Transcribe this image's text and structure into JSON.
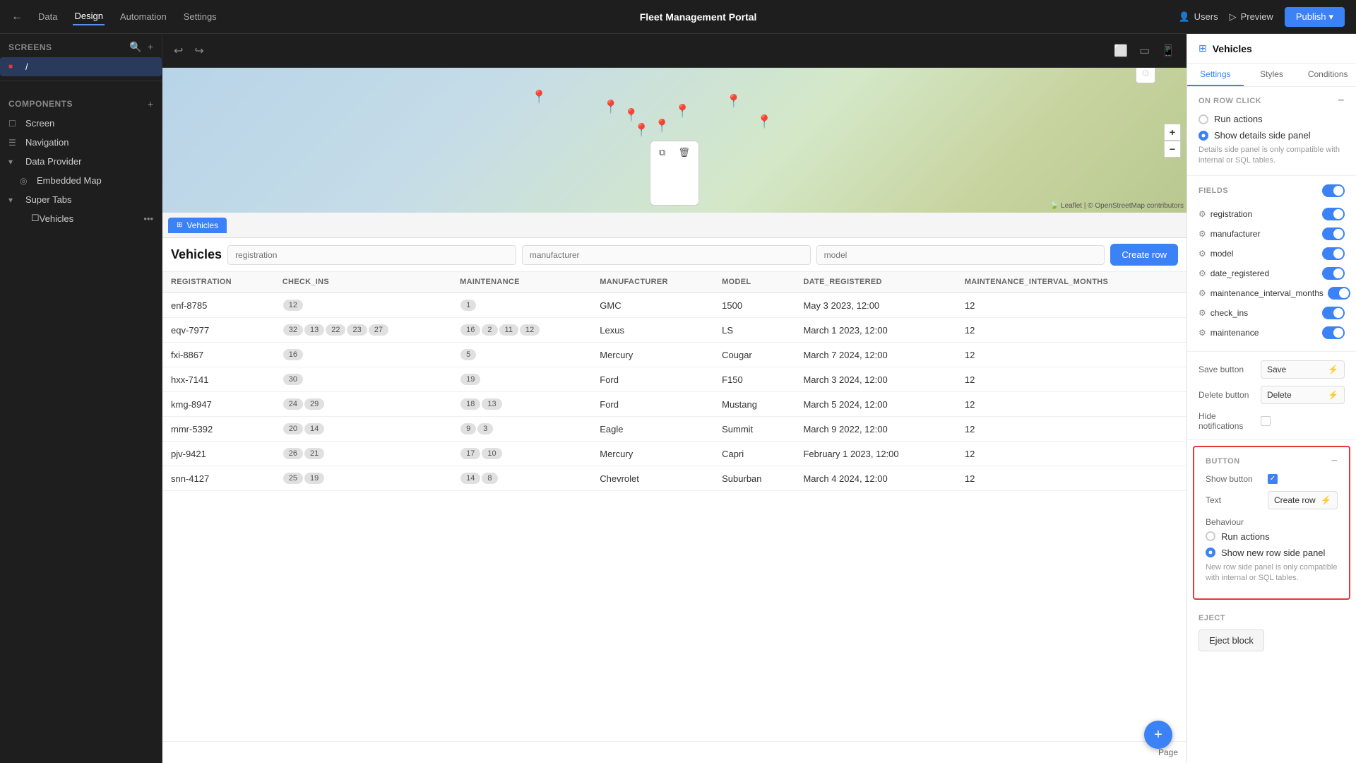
{
  "topNav": {
    "backLabel": "←",
    "tabs": [
      "Data",
      "Design",
      "Automation",
      "Settings"
    ],
    "activeTab": "Design",
    "appTitle": "Fleet Management Portal",
    "usersLabel": "Users",
    "previewLabel": "Preview",
    "publishLabel": "Publish"
  },
  "leftSidebar": {
    "screensTitle": "Screens",
    "screenItem": "/",
    "componentsTitle": "Components",
    "addIcon": "+",
    "items": [
      {
        "label": "Screen",
        "icon": "☐"
      },
      {
        "label": "Navigation",
        "icon": "☰"
      },
      {
        "label": "Data Provider",
        "icon": "◉"
      },
      {
        "label": "Embedded Map",
        "icon": "◎"
      },
      {
        "label": "Super Tabs",
        "icon": "⊞"
      },
      {
        "label": "Vehicles",
        "icon": "☐"
      }
    ]
  },
  "canvas": {
    "tableTabLabel": "Vehicles",
    "tableTitle": "Vehicles",
    "searchPlaceholders": [
      "registration",
      "manufacturer",
      "model"
    ],
    "createRowLabel": "Create row",
    "columns": [
      "REGISTRATION",
      "CHECK_INS",
      "MAINTENANCE",
      "MANUFACTURER",
      "MODEL",
      "DATE_REGISTERED",
      "MAINTENANCE_INTERVAL_MONTHS"
    ],
    "rows": [
      {
        "registration": "enf-8785",
        "check_ins": [
          "12"
        ],
        "maintenance": [
          "1"
        ],
        "manufacturer": "GMC",
        "model": "1500",
        "date_registered": "May 3 2023, 12:00",
        "maintenance_interval": "12"
      },
      {
        "registration": "eqv-7977",
        "check_ins": [
          "32",
          "13",
          "22",
          "23",
          "27"
        ],
        "maintenance": [
          "16",
          "2",
          "11",
          "12"
        ],
        "manufacturer": "Lexus",
        "model": "LS",
        "date_registered": "March 1 2023, 12:00",
        "maintenance_interval": "12"
      },
      {
        "registration": "fxi-8867",
        "check_ins": [
          "16"
        ],
        "maintenance": [
          "5"
        ],
        "manufacturer": "Mercury",
        "model": "Cougar",
        "date_registered": "March 7 2024, 12:00",
        "maintenance_interval": "12"
      },
      {
        "registration": "hxx-7141",
        "check_ins": [
          "30"
        ],
        "maintenance": [
          "19"
        ],
        "manufacturer": "Ford",
        "model": "F150",
        "date_registered": "March 3 2024, 12:00",
        "maintenance_interval": "12"
      },
      {
        "registration": "kmg-8947",
        "check_ins": [
          "24",
          "29"
        ],
        "maintenance": [
          "18",
          "13"
        ],
        "manufacturer": "Ford",
        "model": "Mustang",
        "date_registered": "March 5 2024, 12:00",
        "maintenance_interval": "12"
      },
      {
        "registration": "mmr-5392",
        "check_ins": [
          "20",
          "14"
        ],
        "maintenance": [
          "9",
          "3"
        ],
        "manufacturer": "Eagle",
        "model": "Summit",
        "date_registered": "March 9 2022, 12:00",
        "maintenance_interval": "12"
      },
      {
        "registration": "pjv-9421",
        "check_ins": [
          "26",
          "21"
        ],
        "maintenance": [
          "17",
          "10"
        ],
        "manufacturer": "Mercury",
        "model": "Capri",
        "date_registered": "February 1 2023, 12:00",
        "maintenance_interval": "12"
      },
      {
        "registration": "snn-4127",
        "check_ins": [
          "25",
          "19"
        ],
        "maintenance": [
          "14",
          "8"
        ],
        "manufacturer": "Chevrolet",
        "model": "Suburban",
        "date_registered": "March 4 2024, 12:00",
        "maintenance_interval": "12"
      }
    ],
    "footerLabel": "Page",
    "fabIcon": "+"
  },
  "rightPanel": {
    "title": "Vehicles",
    "tabs": [
      "Settings",
      "Styles",
      "Conditions"
    ],
    "activeTab": "Settings",
    "onRowClickLabel": "ON ROW CLICK",
    "runActionsLabel": "Run actions",
    "showDetailsPanelLabel": "Show details side panel",
    "detailsNote": "Details side panel is only compatible with internal or SQL tables.",
    "fieldsLabel": "Fields",
    "fields": [
      {
        "name": "registration",
        "enabled": true
      },
      {
        "name": "manufacturer",
        "enabled": true
      },
      {
        "name": "model",
        "enabled": true
      },
      {
        "name": "date_registered",
        "enabled": true
      },
      {
        "name": "maintenance_interval_months",
        "enabled": true
      },
      {
        "name": "check_ins",
        "enabled": true
      },
      {
        "name": "maintenance",
        "enabled": true
      }
    ],
    "saveButtonLabel": "Save button",
    "saveButtonValue": "Save",
    "deleteButtonLabel": "Delete button",
    "deleteButtonValue": "Delete",
    "hideNotificationsLabel": "Hide notifications",
    "buttonSectionTitle": "BUTTON",
    "showButtonLabel": "Show button",
    "textLabel": "Text",
    "textValue": "Create row",
    "behaviourLabel": "Behaviour",
    "runActionsOption": "Run actions",
    "showNewRowOption": "Show new row side panel",
    "newRowNote": "New row side panel is only compatible with internal or SQL tables.",
    "ejectSectionTitle": "EJECT",
    "ejectBlockLabel": "Eject block"
  }
}
